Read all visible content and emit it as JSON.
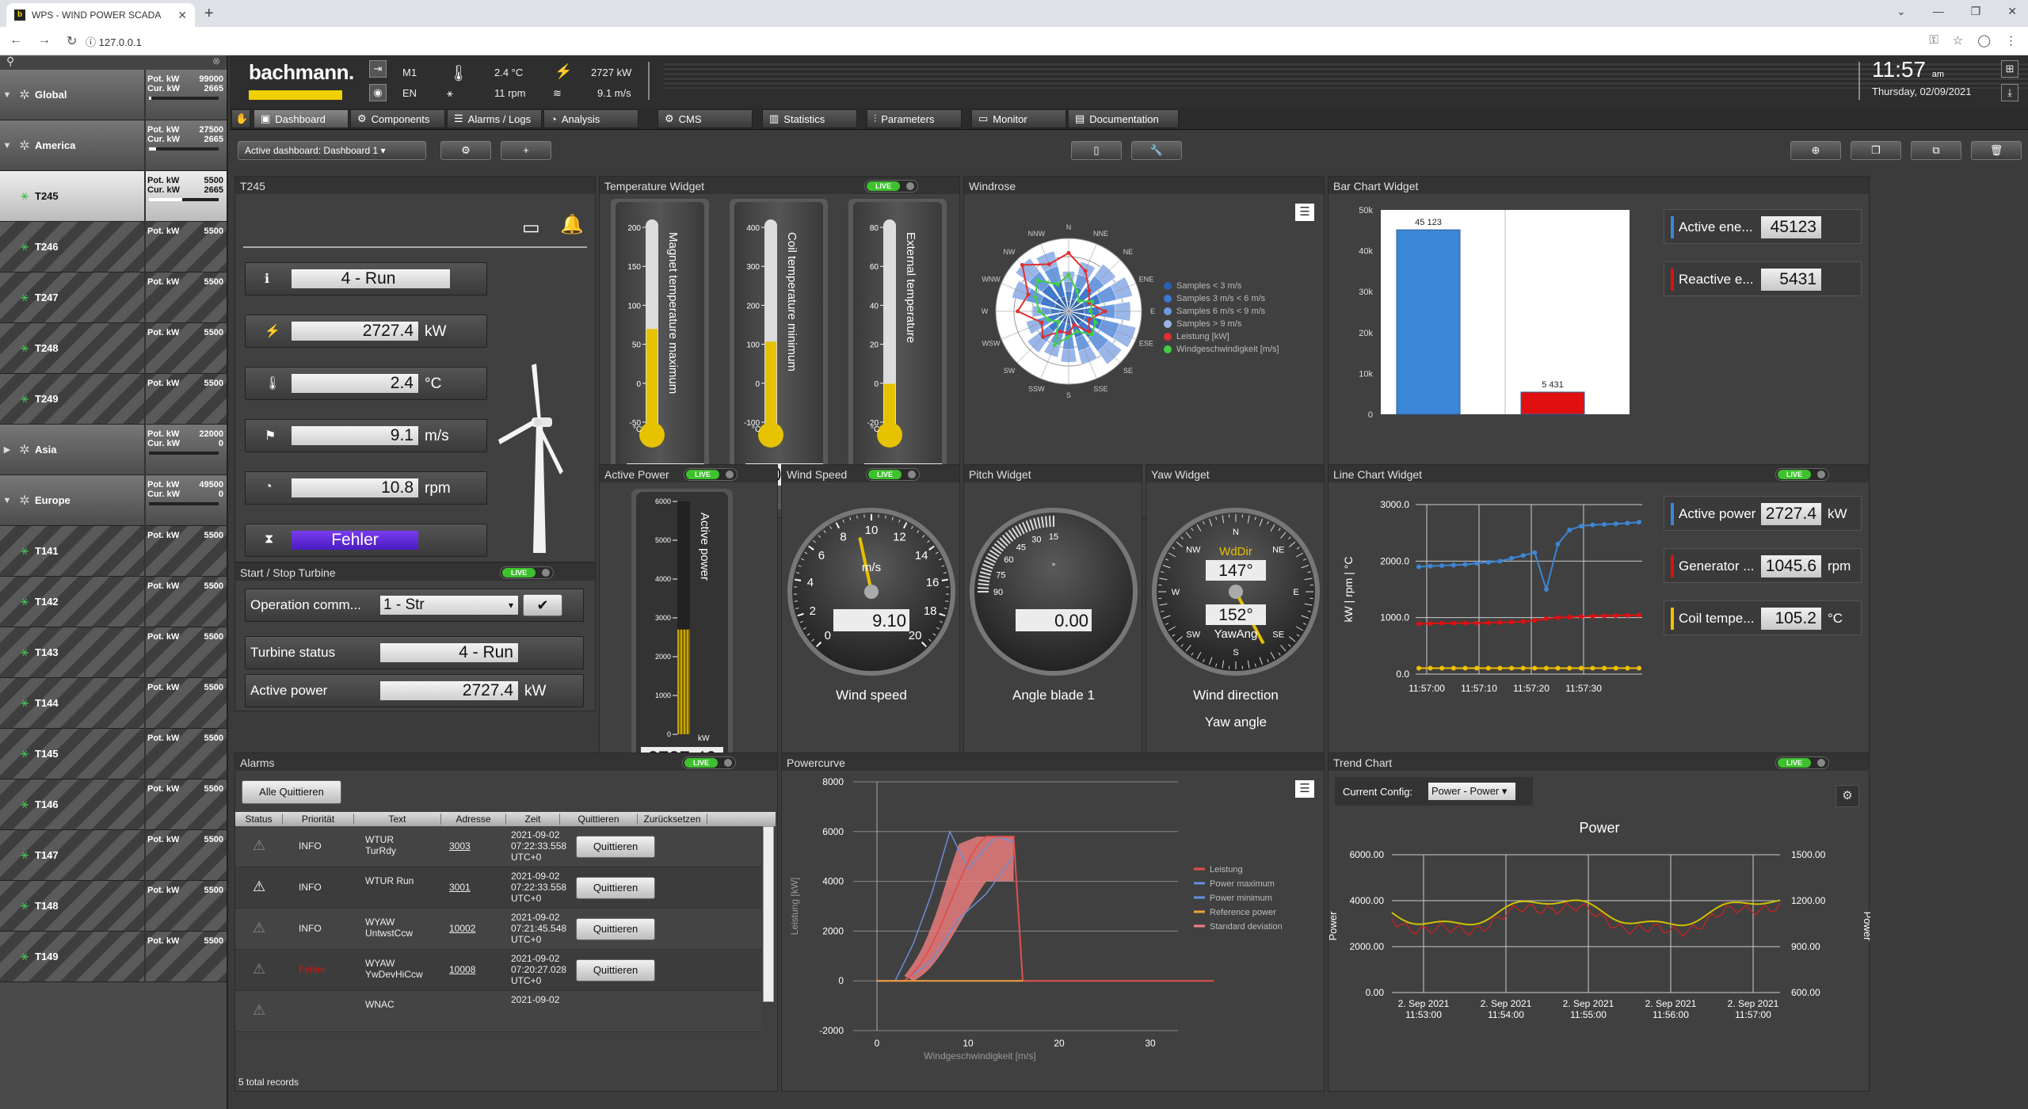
{
  "browser": {
    "tab_title": "WPS - WIND POWER SCADA",
    "url": "127.0.0.1"
  },
  "sidebar": {
    "items": [
      {
        "name": "Global",
        "type": "group",
        "expanded": true,
        "pot": "99000",
        "cur": "2665",
        "fill": 0.03
      },
      {
        "name": "America",
        "type": "group",
        "expanded": true,
        "pot": "27500",
        "cur": "2665",
        "fill": 0.1
      },
      {
        "name": "T245",
        "type": "turbine",
        "selected": true,
        "pot": "5500",
        "cur": "2665",
        "fill": 0.48
      },
      {
        "name": "T246",
        "type": "turbine",
        "pot": "5500"
      },
      {
        "name": "T247",
        "type": "turbine",
        "pot": "5500"
      },
      {
        "name": "T248",
        "type": "turbine",
        "pot": "5500"
      },
      {
        "name": "T249",
        "type": "turbine",
        "pot": "5500"
      },
      {
        "name": "Asia",
        "type": "group",
        "expanded": false,
        "pot": "22000",
        "cur": "0",
        "fill": 0
      },
      {
        "name": "Europe",
        "type": "group",
        "expanded": true,
        "pot": "49500",
        "cur": "0",
        "fill": 0
      },
      {
        "name": "T141",
        "type": "turbine",
        "pot": "5500"
      },
      {
        "name": "T142",
        "type": "turbine",
        "pot": "5500"
      },
      {
        "name": "T143",
        "type": "turbine",
        "pot": "5500"
      },
      {
        "name": "T144",
        "type": "turbine",
        "pot": "5500"
      },
      {
        "name": "T145",
        "type": "turbine",
        "pot": "5500"
      },
      {
        "name": "T146",
        "type": "turbine",
        "pot": "5500"
      },
      {
        "name": "T147",
        "type": "turbine",
        "pot": "5500"
      },
      {
        "name": "T148",
        "type": "turbine",
        "pot": "5500"
      },
      {
        "name": "T149",
        "type": "turbine",
        "pot": "5500"
      }
    ],
    "pot_label": "Pot. kW",
    "cur_label": "Cur. kW"
  },
  "header": {
    "logo": "bachmann.",
    "m": "M1",
    "lang": "EN",
    "temp": "2.4 °C",
    "rpm": "11 rpm",
    "power": "2727 kW",
    "wind": "9.1 m/s",
    "time": "11:57",
    "ampm": "am",
    "date": "Thursday, 02/09/2021"
  },
  "nav": {
    "tabs": [
      "Dashboard",
      "Components",
      "Alarms / Logs",
      "Analysis",
      "CMS",
      "Statistics",
      "Parameters",
      "Monitor",
      "Documentation"
    ]
  },
  "toolbar": {
    "active_label": "Active dashboard:",
    "active_value": "Dashboard 1"
  },
  "t245": {
    "title": "T245",
    "status": "4 - Run",
    "power": "2727.4",
    "power_unit": "kW",
    "temp": "2.4",
    "temp_unit": "°C",
    "wind": "9.1",
    "wind_unit": "m/s",
    "rpm": "10.8",
    "rpm_unit": "rpm",
    "error": "Fehler"
  },
  "startstop": {
    "title": "Start / Stop Turbine",
    "live": "LIVE",
    "op_label": "Operation comm...",
    "op_value": "1 - Str",
    "status_label": "Turbine status",
    "status_value": "4 - Run",
    "power_label": "Active power",
    "power_value": "2727.4",
    "power_unit": "kW"
  },
  "temperature": {
    "title": "Temperature Widget",
    "live": "LIVE",
    "gauges": [
      {
        "label": "Magnet temperature maximum",
        "value": "93.40",
        "ticks": [
          "200",
          "150",
          "100",
          "50",
          "0",
          "-50"
        ],
        "unit": "°C",
        "level": 0.48
      },
      {
        "label": "Coil temperature minimum",
        "value": "104.10",
        "ticks": [
          "400",
          "300",
          "200",
          "100",
          "0",
          "-100"
        ],
        "unit": "°C",
        "level": 0.42
      },
      {
        "label": "External temperature",
        "value": "2.40",
        "ticks": [
          "80",
          "60",
          "40",
          "20",
          "0",
          "-20"
        ],
        "unit": "°C",
        "level": 0.22
      }
    ]
  },
  "windrose": {
    "title": "Windrose",
    "directions": [
      "N",
      "NNE",
      "NE",
      "ENE",
      "E",
      "ESE",
      "SE",
      "SSE",
      "S",
      "SSW",
      "SW",
      "WSW",
      "W",
      "WNW",
      "NW",
      "NNW"
    ],
    "legend": [
      {
        "label": "Samples < 3 m/s",
        "color": "#2a5fb0"
      },
      {
        "label": "Samples 3 m/s < 6 m/s",
        "color": "#3c78d0"
      },
      {
        "label": "Samples 6 m/s < 9 m/s",
        "color": "#6b9ae0"
      },
      {
        "label": "Samples > 9 m/s",
        "color": "#9ab6e8"
      },
      {
        "label": "Leistung [kW]",
        "color": "#e03030"
      },
      {
        "label": "Windgeschwindigkeit [m/s]",
        "color": "#40d040"
      }
    ]
  },
  "barchart": {
    "title": "Bar Chart Widget",
    "chart_data": {
      "type": "bar",
      "categories": [
        "Active energy",
        "Reactive energy"
      ],
      "values": [
        45123,
        5431
      ],
      "data_labels": [
        "45 123",
        "5 431"
      ],
      "colors": [
        "#3b86d6",
        "#e01010"
      ],
      "yticks": [
        "50k",
        "40k",
        "30k",
        "20k",
        "10k",
        "0"
      ],
      "ylim": [
        0,
        50000
      ]
    },
    "kpis": [
      {
        "label": "Active ene...",
        "value": "45123",
        "color": "#3b86d6"
      },
      {
        "label": "Reactive e...",
        "value": "5431",
        "color": "#e01010"
      }
    ]
  },
  "activepower": {
    "title": "Active Power",
    "live": "LIVE",
    "label": "Active power",
    "value": "2727.40",
    "unit": "kW",
    "ticks": [
      "6000",
      "5000",
      "4000",
      "3000",
      "2000",
      "1000",
      "0"
    ],
    "level": 0.45
  },
  "windspeed": {
    "title": "Wind Speed",
    "live": "LIVE",
    "unit": "m/s",
    "value": "9.10",
    "caption": "Wind speed",
    "ticks": [
      "0",
      "2",
      "4",
      "6",
      "8",
      "10",
      "12",
      "14",
      "16",
      "18",
      "20"
    ]
  },
  "pitch": {
    "title": "Pitch Widget",
    "value": "0.00",
    "caption": "Angle blade 1",
    "ticks": [
      "90",
      "75",
      "60",
      "45",
      "30",
      "15"
    ]
  },
  "yaw": {
    "title": "Yaw Widget",
    "dir_label": "WdDir",
    "dir_value": "147°",
    "yaw_label": "YawAng",
    "yaw_value": "152°",
    "caption1": "Wind direction",
    "caption2": "Yaw angle",
    "dirs": [
      "N",
      "NE",
      "E",
      "SE",
      "S",
      "SW",
      "W",
      "NW"
    ]
  },
  "linechart": {
    "title": "Line Chart Widget",
    "live": "LIVE",
    "ylabel": "kW | rpm | °C",
    "xticks": [
      "11:57:00",
      "11:57:10",
      "11:57:20",
      "11:57:30"
    ],
    "yticks": [
      "3000.0",
      "2000.0",
      "1000.0",
      "0.0"
    ],
    "chart_data": {
      "type": "line",
      "x": [
        "11:56:57",
        "11:56:59",
        "11:57:01",
        "11:57:03",
        "11:57:05",
        "11:57:07",
        "11:57:09",
        "11:57:11",
        "11:57:13",
        "11:57:15",
        "11:57:17",
        "11:57:19",
        "11:57:21",
        "11:57:23",
        "11:57:25",
        "11:57:27",
        "11:57:29",
        "11:57:31",
        "11:57:33",
        "11:57:35"
      ],
      "ylim": [
        0,
        3000
      ],
      "series": [
        {
          "name": "Active power",
          "color": "#3b86d6",
          "values": [
            1900,
            1910,
            1920,
            1930,
            1940,
            1960,
            1980,
            2000,
            2050,
            2100,
            2150,
            1500,
            2300,
            2550,
            2620,
            2640,
            2650,
            2660,
            2670,
            2690
          ]
        },
        {
          "name": "Generator ...",
          "color": "#e01010",
          "values": [
            890,
            895,
            900,
            900,
            905,
            905,
            910,
            915,
            920,
            930,
            950,
            980,
            1000,
            1010,
            1020,
            1025,
            1030,
            1035,
            1040,
            1045
          ]
        },
        {
          "name": "Coil tempe...",
          "color": "#f0c000",
          "values": [
            105,
            105,
            105,
            105,
            105,
            105,
            105,
            105,
            105,
            105,
            105,
            105,
            105,
            105,
            105,
            105,
            105,
            105,
            105,
            105
          ]
        }
      ]
    }
  },
  "linekpis": [
    {
      "label": "Active power",
      "value": "2727.4",
      "unit": "kW",
      "color": "#3b86d6"
    },
    {
      "label": "Generator ...",
      "value": "1045.6",
      "unit": "rpm",
      "color": "#e01010"
    },
    {
      "label": "Coil tempe...",
      "value": "105.2",
      "unit": "°C",
      "color": "#f0c000"
    }
  ],
  "alarms": {
    "title": "Alarms",
    "live": "LIVE",
    "ack_all": "Alle Quittieren",
    "columns": [
      "Status",
      "Priorität",
      "Text",
      "Adresse",
      "Zeit",
      "Quittieren",
      "Zurücksetzen"
    ],
    "rows": [
      {
        "prio": "INFO",
        "text1": "WTUR",
        "text2": "TurRdy",
        "addr": "3003",
        "t1": "2021-09-02",
        "t2": "07:22:33.558",
        "t3": "UTC+0",
        "btn": "Quittieren",
        "active": false
      },
      {
        "prio": "INFO",
        "text1": "WTUR Run",
        "text2": "",
        "addr": "3001",
        "t1": "2021-09-02",
        "t2": "07:22:33.558",
        "t3": "UTC+0",
        "btn": "Quittieren",
        "active": true
      },
      {
        "prio": "INFO",
        "text1": "WYAW",
        "text2": "UntwstCcw",
        "addr": "10002",
        "t1": "2021-09-02",
        "t2": "07:21:45.548",
        "t3": "UTC+0",
        "btn": "Quittieren",
        "active": false
      },
      {
        "prio": "Fehler",
        "text1": "WYAW",
        "text2": "YwDevHiCcw",
        "addr": "10008",
        "t1": "2021-09-02",
        "t2": "07:20:27.028",
        "t3": "UTC+0",
        "btn": "Quittieren",
        "active": false
      },
      {
        "prio": "",
        "text1": "WNAC",
        "text2": "",
        "addr": "",
        "t1": "2021-09-02",
        "t2": "",
        "t3": "",
        "btn": "",
        "active": false
      }
    ],
    "total": "5 total records"
  },
  "powercurve": {
    "title": "Powercurve",
    "xlabel": "Windgeschwindigkeit [m/s]",
    "ylabel": "Leistung [kW]",
    "xticks": [
      "0",
      "10",
      "20",
      "30"
    ],
    "yticks": [
      "8000",
      "6000",
      "4000",
      "2000",
      "0",
      "-2000"
    ],
    "legend": [
      {
        "label": "Leistung",
        "color": "#e05050"
      },
      {
        "label": "Power maximum",
        "color": "#6a8fd8"
      },
      {
        "label": "Power minimum",
        "color": "#6a8fd8"
      },
      {
        "label": "Reference power",
        "color": "#f0a040"
      },
      {
        "label": "Standard deviation",
        "color": "#f08080"
      }
    ]
  },
  "trend": {
    "title": "Trend Chart",
    "live": "LIVE",
    "config_label": "Current Config:",
    "config_value": "Power - Power",
    "chart_title": "Power",
    "ylabel_left": "Power",
    "ylabel_right": "Power",
    "yticks_left": [
      "6000.00",
      "4000.00",
      "2000.00",
      "0.00"
    ],
    "yticks_right": [
      "1500.00",
      "1200.00",
      "900.00",
      "600.00"
    ],
    "xticks": [
      [
        "2. Sep 2021",
        "11:53:00"
      ],
      [
        "2. Sep 2021",
        "11:54:00"
      ],
      [
        "2. Sep 2021",
        "11:55:00"
      ],
      [
        "2. Sep 2021",
        "11:56:00"
      ],
      [
        "2. Sep 2021",
        "11:57:00"
      ]
    ]
  }
}
